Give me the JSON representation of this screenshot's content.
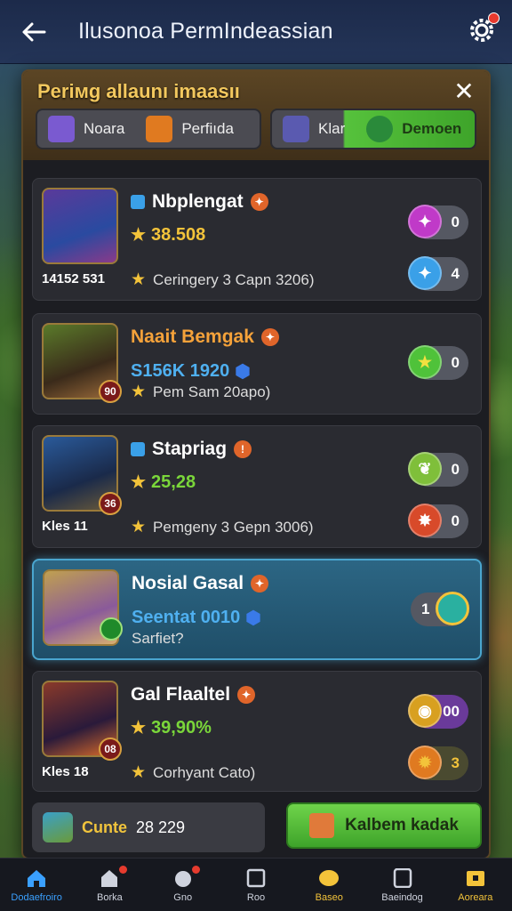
{
  "header": {
    "title": "Ilusonoa PermIndeassian"
  },
  "panel": {
    "title": "Periмg allaunı imaasıı",
    "close_label": "✕",
    "tabs": [
      {
        "label": "Noara"
      },
      {
        "label": "Perfiıda"
      },
      {
        "label": "Klar"
      },
      {
        "label": "Demoen"
      }
    ]
  },
  "rows": [
    {
      "name": "Nbplengat",
      "stat": "38.508",
      "badge": "",
      "sub": "14152 531",
      "desc": "Ceringery 3 Capn 3206)",
      "pills": [
        {
          "count": "0",
          "color": "#c03ac8"
        },
        {
          "count": "4",
          "color": "#3aa0e8"
        }
      ]
    },
    {
      "name": "Naait Bemgak",
      "stat": "S156K 1920",
      "badge": "90",
      "sub": "",
      "desc": "Pem Sam 20apo)",
      "pills": [
        {
          "count": "0",
          "color": "#4fc23a"
        }
      ]
    },
    {
      "name": "Stapriag",
      "stat": "25,28",
      "badge": "36",
      "sub": "Kles 11",
      "desc": "Pemgeny 3 Gepn 3006)",
      "pills": [
        {
          "count": "0",
          "color": "#7fbf3a"
        },
        {
          "count": "0",
          "color": "#d84a2a"
        }
      ]
    },
    {
      "name": "Nosial Gasal",
      "stat": "Seentat 0010",
      "badge": "",
      "sub": "",
      "desc": "Sarfiet?",
      "pills": [
        {
          "count": "1",
          "color": "#2ab0a0"
        }
      ]
    },
    {
      "name": "Gal Flaaltel",
      "stat": "39,90%",
      "badge": "08",
      "sub": "Kles 18",
      "desc": "Corhyant Cato)",
      "pills": [
        {
          "count": "00",
          "color": "#d8a020"
        },
        {
          "count": "3",
          "color": "#e07a20"
        }
      ]
    }
  ],
  "footer": {
    "count_label": "Cunte",
    "count_value": "28 229",
    "button_label": "Kalbem kadak"
  },
  "bottom_nav": [
    {
      "label": "Dodaefroiro"
    },
    {
      "label": "Borka"
    },
    {
      "label": "Gno"
    },
    {
      "label": "Roo"
    },
    {
      "label": "Baseo"
    },
    {
      "label": "Baeindog"
    },
    {
      "label": "Aoreara"
    }
  ]
}
